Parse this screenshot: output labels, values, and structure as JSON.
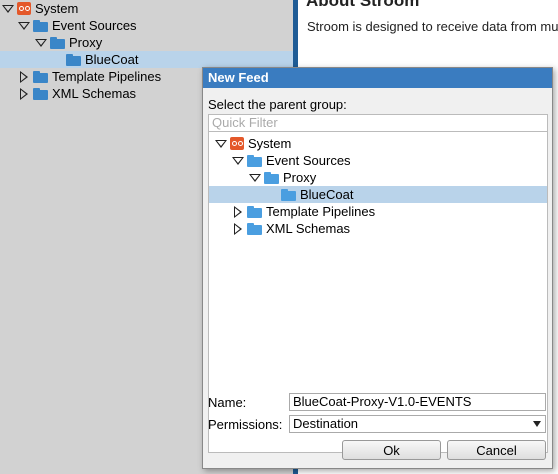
{
  "left_tree": {
    "items": [
      {
        "label": "System"
      },
      {
        "label": "Event Sources"
      },
      {
        "label": "Proxy"
      },
      {
        "label": "BlueCoat"
      },
      {
        "label": "Template Pipelines"
      },
      {
        "label": "XML Schemas"
      }
    ]
  },
  "about": {
    "heading": "About Stroom",
    "text": "Stroom is designed to receive data from mu"
  },
  "dialog": {
    "title": "New Feed",
    "parent_label": "Select the parent group:",
    "filter_placeholder": "Quick Filter",
    "tree": {
      "items": [
        {
          "label": "System"
        },
        {
          "label": "Event Sources"
        },
        {
          "label": "Proxy"
        },
        {
          "label": "BlueCoat"
        },
        {
          "label": "Template Pipelines"
        },
        {
          "label": "XML Schemas"
        }
      ]
    },
    "name_label": "Name:",
    "name_value": "BlueCoat-Proxy-V1.0-EVENTS",
    "permissions_label": "Permissions:",
    "permissions_value": "Destination",
    "ok_label": "Ok",
    "cancel_label": "Cancel"
  },
  "colors": {
    "title_bar": "#3a7cc0",
    "selection": "#b9d3ea",
    "folder": "#3a86c8",
    "system_icon": "#e4582a",
    "pane_border": "#1f5c96"
  }
}
